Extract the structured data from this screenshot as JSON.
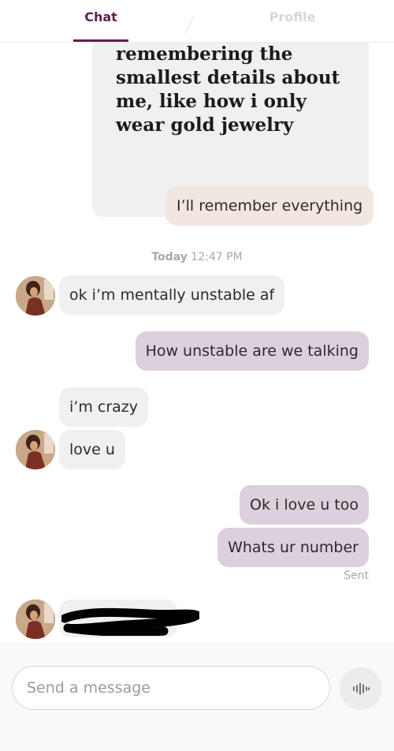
{
  "header": {
    "tabs": [
      {
        "label": "Chat",
        "active": true
      },
      {
        "label": "Profile",
        "active": false
      }
    ]
  },
  "story": {
    "text": "remembering the smallest details about me, like how i only wear gold jewelry",
    "reply": "I’ll remember everything"
  },
  "timestamp": {
    "day": "Today",
    "time": "12:47 PM"
  },
  "messages": [
    {
      "direction": "incoming",
      "text": "ok i’m mentally unstable af"
    },
    {
      "direction": "outgoing",
      "text": "How unstable are we talking"
    },
    {
      "direction": "incoming",
      "text": "i’m crazy"
    },
    {
      "direction": "incoming",
      "text": "love u"
    },
    {
      "direction": "outgoing",
      "text": "Ok i love u too"
    },
    {
      "direction": "outgoing",
      "text": "Whats ur number"
    }
  ],
  "status": {
    "sent": "Sent"
  },
  "composer": {
    "placeholder": "Send a message",
    "voice_icon": "voice-waveform-icon"
  },
  "colors": {
    "brand": "#5b2150",
    "outgoing_bubble": "#ddd0dd",
    "incoming_bubble": "#f0f0f0",
    "story_reply_bubble": "#f2e6e0"
  }
}
